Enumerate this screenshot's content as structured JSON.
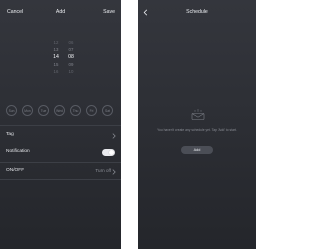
{
  "add_screen": {
    "cancel_label": "Cancel",
    "title": "Add",
    "save_label": "Save",
    "picker": {
      "hours": [
        "",
        "12",
        "13",
        "14",
        "15",
        "16"
      ],
      "minutes": [
        "",
        "06",
        "07",
        "08",
        "09",
        "10"
      ],
      "selected_hour": "14",
      "selected_minute": "08"
    },
    "weekdays": [
      "Sun",
      "Mon",
      "Tue",
      "Wed",
      "Thu",
      "Fri",
      "Sat"
    ],
    "tag_label": "Tag",
    "notification_label": "Notification",
    "notification_on": true,
    "onoff_label": "ON/OFF",
    "onoff_value": "Turn off"
  },
  "schedule_screen": {
    "back_icon": "chevron-left-icon",
    "title": "Schedule",
    "empty_message": "You haven't create any schedule yet. Tap 'Add' to start.",
    "add_label": "Add"
  },
  "colors": {
    "background_top": "#34363d",
    "background_bottom": "#24262b",
    "primary_text": "#eceef2",
    "secondary_text": "#8d9098",
    "toggle_on": "#e9eaee"
  }
}
